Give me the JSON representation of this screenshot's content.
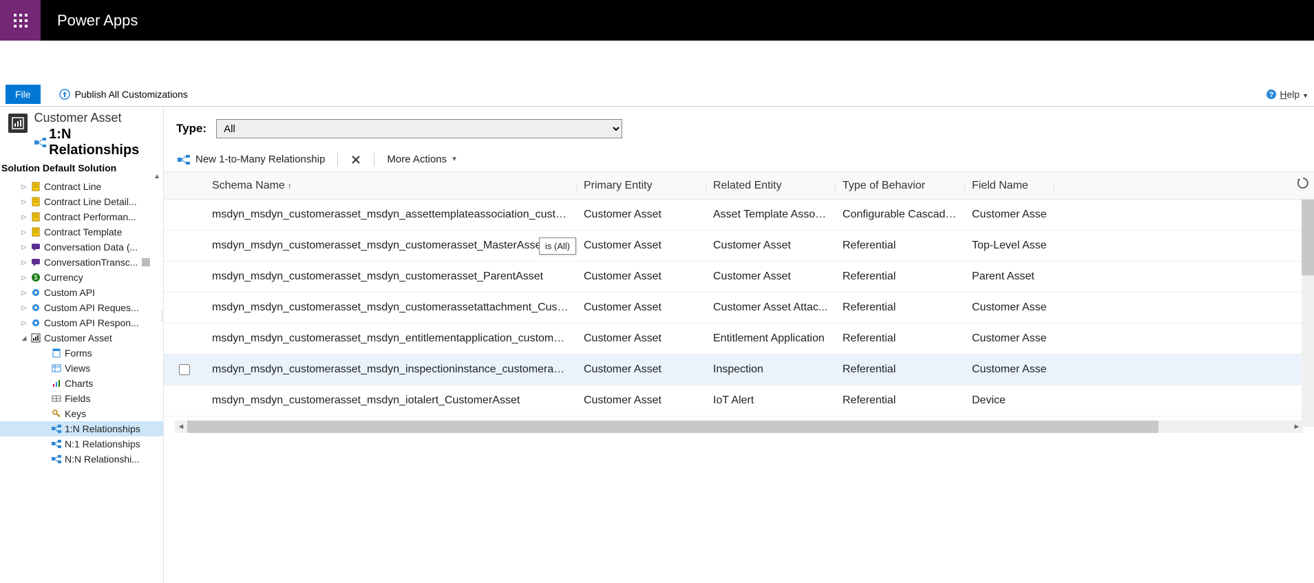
{
  "header": {
    "brand": "Power Apps"
  },
  "commandbar": {
    "file": "File",
    "publish": "Publish All Customizations",
    "help": "Help"
  },
  "sidebar": {
    "entity_title": "Customer Asset",
    "page_title": "1:N Relationships",
    "solution_label": "Solution Default Solution",
    "items": [
      {
        "label": "Contract Line",
        "icon": "contract"
      },
      {
        "label": "Contract Line Detail...",
        "icon": "contract"
      },
      {
        "label": "Contract Performan...",
        "icon": "contract"
      },
      {
        "label": "Contract Template",
        "icon": "contract"
      },
      {
        "label": "Conversation Data (...",
        "icon": "conv"
      },
      {
        "label": "ConversationTransc...",
        "icon": "conv",
        "badge": true
      },
      {
        "label": "Currency",
        "icon": "currency"
      },
      {
        "label": "Custom API",
        "icon": "api"
      },
      {
        "label": "Custom API Reques...",
        "icon": "api"
      },
      {
        "label": "Custom API Respon...",
        "icon": "api"
      },
      {
        "label": "Customer Asset",
        "icon": "entity",
        "expanded": true
      }
    ],
    "children": [
      {
        "label": "Forms",
        "icon": "form"
      },
      {
        "label": "Views",
        "icon": "view"
      },
      {
        "label": "Charts",
        "icon": "chart"
      },
      {
        "label": "Fields",
        "icon": "field"
      },
      {
        "label": "Keys",
        "icon": "key"
      },
      {
        "label": "1:N Relationships",
        "icon": "rel",
        "selected": true
      },
      {
        "label": "N:1 Relationships",
        "icon": "rel"
      },
      {
        "label": "N:N Relationshi...",
        "icon": "rel"
      }
    ]
  },
  "filter": {
    "label": "Type:",
    "value": "All"
  },
  "toolbar": {
    "new": "New 1-to-Many Relationship",
    "more": "More Actions"
  },
  "columns": {
    "schema": "Schema Name",
    "primary": "Primary Entity",
    "related": "Related Entity",
    "behavior": "Type of Behavior",
    "field": "Field Name"
  },
  "tooltip": "is (All)",
  "rows": [
    {
      "schema": "msdyn_msdyn_customerasset_msdyn_assettemplateassociation_customera...",
      "primary": "Customer Asset",
      "related": "Asset Template Associ...",
      "behavior": "Configurable Cascading",
      "field": "Customer Asse"
    },
    {
      "schema": "msdyn_msdyn_customerasset_msdyn_customerasset_MasterAsset",
      "primary": "Customer Asset",
      "related": "Customer Asset",
      "behavior": "Referential",
      "field": "Top-Level Asse",
      "tooltip": true
    },
    {
      "schema": "msdyn_msdyn_customerasset_msdyn_customerasset_ParentAsset",
      "primary": "Customer Asset",
      "related": "Customer Asset",
      "behavior": "Referential",
      "field": "Parent Asset"
    },
    {
      "schema": "msdyn_msdyn_customerasset_msdyn_customerassetattachment_Customer...",
      "primary": "Customer Asset",
      "related": "Customer Asset Attac...",
      "behavior": "Referential",
      "field": "Customer Asse"
    },
    {
      "schema": "msdyn_msdyn_customerasset_msdyn_entitlementapplication_customerasset",
      "primary": "Customer Asset",
      "related": "Entitlement Application",
      "behavior": "Referential",
      "field": "Customer Asse"
    },
    {
      "schema": "msdyn_msdyn_customerasset_msdyn_inspectioninstance_customerassetid",
      "primary": "Customer Asset",
      "related": "Inspection",
      "behavior": "Referential",
      "field": "Customer Asse",
      "hover": true
    },
    {
      "schema": "msdyn_msdyn_customerasset_msdyn_iotalert_CustomerAsset",
      "primary": "Customer Asset",
      "related": "IoT Alert",
      "behavior": "Referential",
      "field": "Device"
    }
  ]
}
